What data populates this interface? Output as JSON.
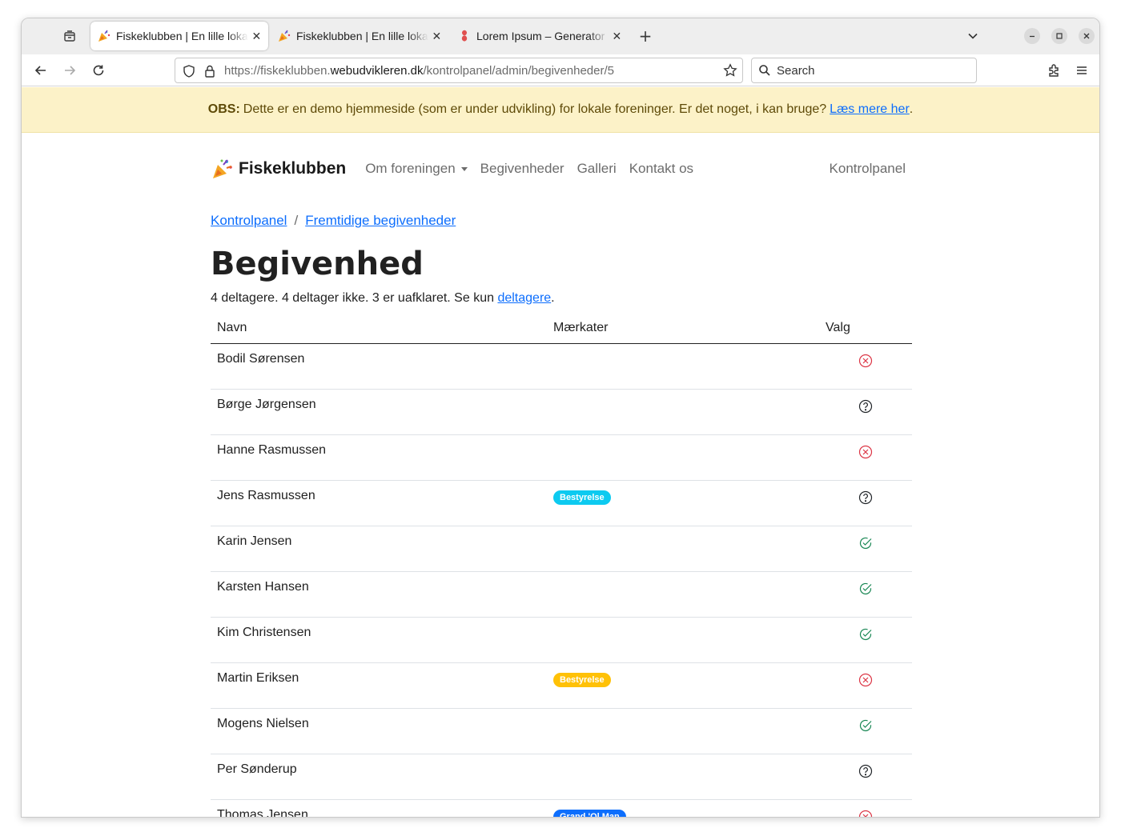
{
  "browser": {
    "tabs": [
      {
        "title": "Fiskeklubben | En lille lokal forening",
        "active": true,
        "favicon": "party-popper-icon"
      },
      {
        "title": "Fiskeklubben | En lille lokal forening",
        "active": false,
        "favicon": "party-popper-icon"
      },
      {
        "title": "Lorem Ipsum – Generator",
        "active": false,
        "favicon": "lorem-ipsum-icon"
      }
    ],
    "url_prefix": "https://fiskeklubben.",
    "url_host": "webudvikleren.dk",
    "url_path": "/kontrolpanel/admin/begivenheder/5",
    "search_placeholder": "Search"
  },
  "notice": {
    "label": "OBS:",
    "text": "Dette er en demo hjemmeside (som er under udvikling) for lokale foreninger. Er det noget, i kan bruge?",
    "link": "Læs mere her",
    "suffix": "."
  },
  "site": {
    "brand": "Fiskeklubben",
    "nav": {
      "about": "Om foreningen",
      "events": "Begivenheder",
      "gallery": "Galleri",
      "contact": "Kontakt os",
      "dashboard": "Kontrolpanel"
    }
  },
  "breadcrumb": {
    "home": "Kontrolpanel",
    "separator": "/",
    "current": "Fremtidige begivenheder"
  },
  "page": {
    "title": "Begivenhed",
    "summary_text": "4 deltagere. 4 deltager ikke. 3 er uafklaret. Se kun",
    "summary_link": "deltagere",
    "summary_end": "."
  },
  "table": {
    "headers": {
      "name": "Navn",
      "tags": "Mærkater",
      "choice": "Valg"
    },
    "rows": [
      {
        "name": "Bodil Sørensen",
        "tag": "",
        "tag_color": "",
        "status": "declined"
      },
      {
        "name": "Børge Jørgensen",
        "tag": "",
        "tag_color": "",
        "status": "unknown"
      },
      {
        "name": "Hanne Rasmussen",
        "tag": "",
        "tag_color": "",
        "status": "declined"
      },
      {
        "name": "Jens Rasmussen",
        "tag": "Bestyrelse",
        "tag_color": "#0dcaf0",
        "status": "unknown"
      },
      {
        "name": "Karin Jensen",
        "tag": "",
        "tag_color": "",
        "status": "accepted"
      },
      {
        "name": "Karsten Hansen",
        "tag": "",
        "tag_color": "",
        "status": "accepted"
      },
      {
        "name": "Kim Christensen",
        "tag": "",
        "tag_color": "",
        "status": "accepted"
      },
      {
        "name": "Martin Eriksen",
        "tag": "Bestyrelse",
        "tag_color": "#ffc107",
        "status": "declined"
      },
      {
        "name": "Mogens Nielsen",
        "tag": "",
        "tag_color": "",
        "status": "accepted"
      },
      {
        "name": "Per Sønderup",
        "tag": "",
        "tag_color": "",
        "status": "unknown"
      },
      {
        "name": "Thomas Jensen",
        "tag": "Grand 'Ol Man",
        "tag_color": "#0d6efd",
        "status": "declined"
      }
    ],
    "status_colors": {
      "declined": "#dc3545",
      "unknown": "#212529",
      "accepted": "#198754"
    }
  }
}
